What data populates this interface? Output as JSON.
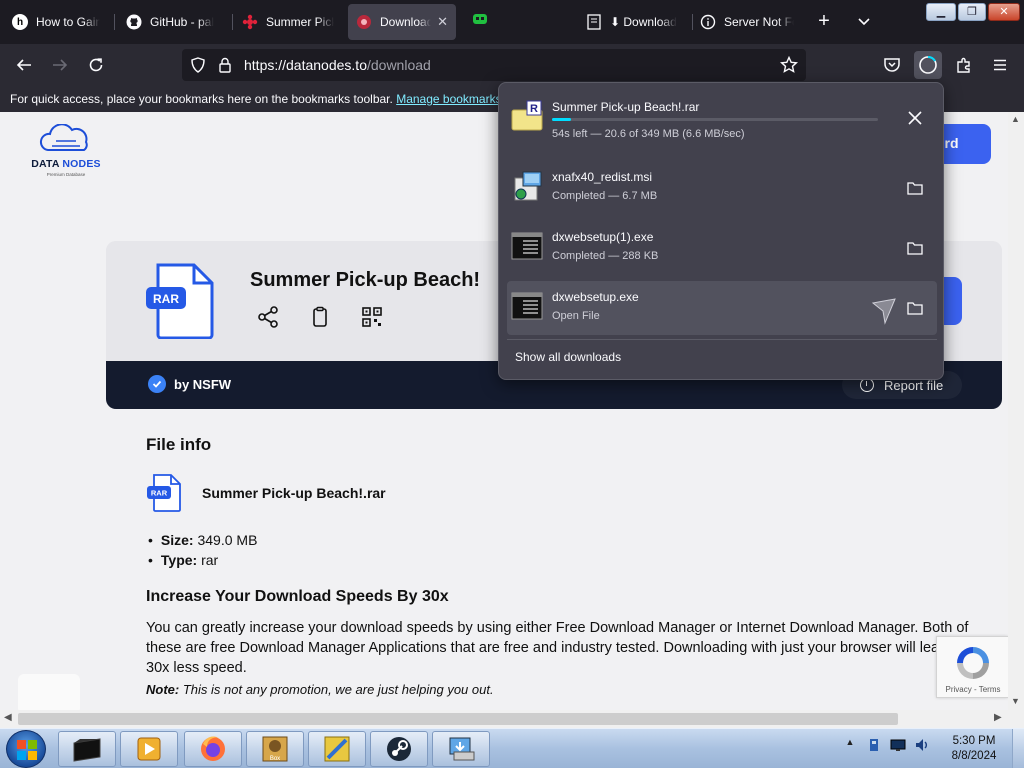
{
  "browser": {
    "tabs": [
      {
        "title": "How to Gain",
        "favicon": "h-logo-icon"
      },
      {
        "title": "GitHub - pal",
        "favicon": "github-icon"
      },
      {
        "title": "Summer Pick",
        "favicon": "red-shuriken-icon"
      },
      {
        "title": "Download",
        "favicon": "record-icon",
        "active": true
      },
      {
        "title": "",
        "favicon": "green-mask-icon"
      },
      {
        "title": "⬇ Download",
        "favicon": "document-icon"
      },
      {
        "title": "Server Not Fo",
        "favicon": "info-icon"
      }
    ],
    "url": {
      "host": "https://datanodes.to",
      "path": "/download"
    },
    "bookmarks_bar": {
      "message": "For quick access, place your bookmarks here on the bookmarks toolbar.",
      "link": "Manage bookmarks..."
    },
    "accent_color": "#00ddff"
  },
  "downloads_panel": {
    "items": [
      {
        "name": "Summer Pick-up Beach!.rar",
        "status": "54s left — 20.6 of 349 MB (6.6 MB/sec)",
        "progress": 0.059,
        "action": "cancel-icon"
      },
      {
        "name": "xnafx40_redist.msi",
        "status": "Completed — 6.7 MB",
        "action": "folder-icon"
      },
      {
        "name": "dxwebsetup(1).exe",
        "status": "Completed — 288 KB",
        "action": "folder-icon"
      },
      {
        "name": "dxwebsetup.exe",
        "status": "Open File",
        "action": "folder-icon"
      }
    ],
    "show_all": "Show all downloads"
  },
  "page": {
    "logo": {
      "part1": "DATA",
      "part2": "NODES",
      "tagline": "Premium Database"
    },
    "signup_partial": "ord",
    "file_title": "Summer Pick-up Beach!",
    "file_badge": "RAR",
    "uploader_prefix": "by",
    "uploader": "NSFW",
    "report": "Report file",
    "file_info_heading": "File info",
    "file_name": "Summer Pick-up Beach!.rar",
    "size_label": "Size:",
    "size_value": "349.0 MB",
    "type_label": "Type:",
    "type_value": "rar",
    "speed_heading": "Increase Your Download Speeds By 30x",
    "speed_text": "You can greatly increase your download speeds by using either Free Download Manager or Internet Download Manager. Both of these are free Download Manager Applications that are free and industry tested. Downloading with just your browser will lead to 30x less speed.",
    "note_label": "Note:",
    "note_text": "This is not any promotion, we are just helping you out.",
    "recaptcha": "Privacy - Terms"
  },
  "taskbar": {
    "apps": [
      "terminal-icon",
      "media-player-icon",
      "firefox-icon",
      "game-box-icon",
      "tools-icon",
      "steam-icon",
      "installer-icon"
    ],
    "time": "5:30 PM",
    "date": "8/8/2024"
  }
}
